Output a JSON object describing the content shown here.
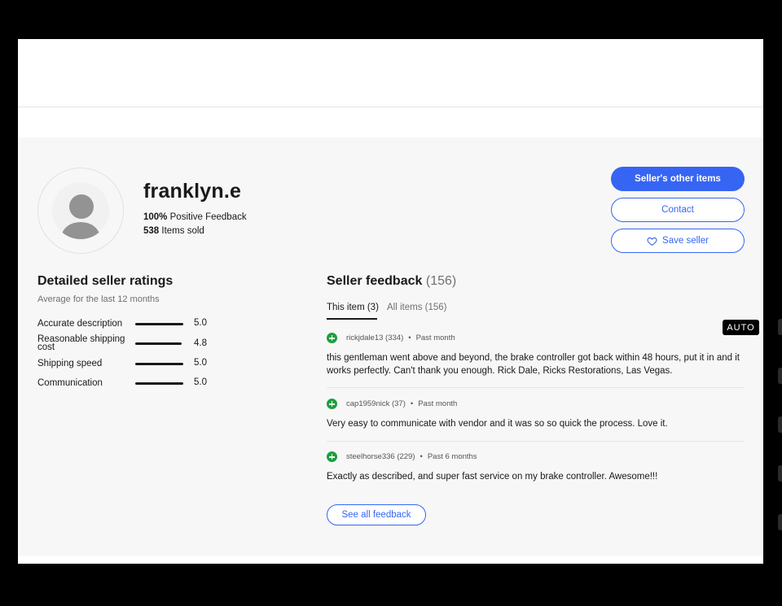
{
  "seller": {
    "name": "franklyn.e",
    "positive_pct": "100%",
    "positive_label": "Positive Feedback",
    "items_sold_count": "538",
    "items_sold_label": "Items sold"
  },
  "actions": {
    "other_items": "Seller's other items",
    "contact": "Contact",
    "save_seller": "Save seller"
  },
  "ratings": {
    "title": "Detailed seller ratings",
    "subtitle": "Average for the last 12 months",
    "items": [
      {
        "label": "Accurate description",
        "value": "5.0",
        "fraction": 1.0
      },
      {
        "label": "Reasonable shipping cost",
        "value": "4.8",
        "fraction": 0.96
      },
      {
        "label": "Shipping speed",
        "value": "5.0",
        "fraction": 1.0
      },
      {
        "label": "Communication",
        "value": "5.0",
        "fraction": 1.0
      }
    ]
  },
  "feedback": {
    "title": "Seller feedback",
    "count": "(156)",
    "tabs": [
      {
        "label": "This item (3)",
        "active": true
      },
      {
        "label": "All items (156)",
        "active": false
      }
    ],
    "entries": [
      {
        "user": "rickjdale13 (334)",
        "time": "Past month",
        "text": "this gentleman went above and beyond, the brake controller got back within 48 hours, put it in and it works perfectly. Can't thank you enough. Rick Dale, Ricks Restorations, Las Vegas."
      },
      {
        "user": "cap1959nick (37)",
        "time": "Past month",
        "text": "Very easy to communicate with vendor and it was so so quick the process. Love it."
      },
      {
        "user": "steelhorse336 (229)",
        "time": "Past 6 months",
        "text": "Exactly as described, and super fast service on my brake controller. Awesome!!!"
      }
    ],
    "see_all": "See all feedback"
  },
  "overlay": {
    "auto_badge": "AUTO"
  },
  "colors": {
    "accent": "#3665f3",
    "positive": "#1e9e3e",
    "panel_bg": "#f7f7f7"
  },
  "icons": {
    "avatar": "person-silhouette-icon",
    "save": "heart-outline-icon",
    "positive": "plus-circle-icon"
  }
}
